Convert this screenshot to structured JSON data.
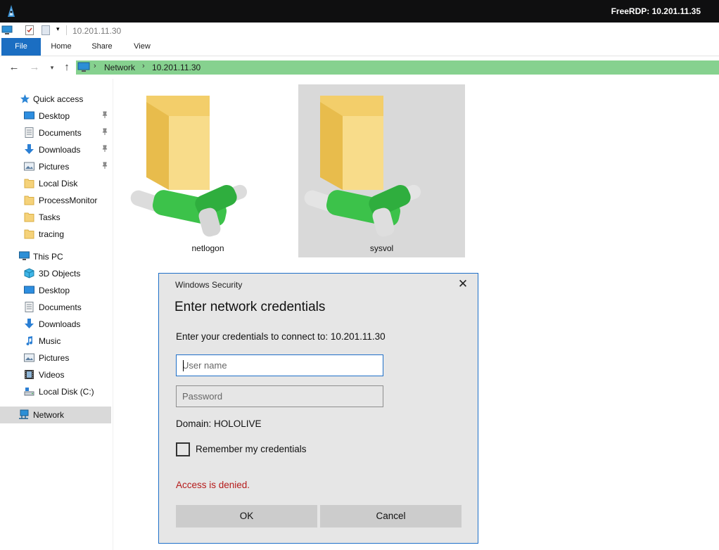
{
  "rdp": {
    "title": "FreeRDP: 10.201.11.35"
  },
  "window": {
    "title": "10.201.11.30"
  },
  "ribbon": {
    "tabs": [
      "File",
      "Home",
      "Share",
      "View"
    ]
  },
  "address": {
    "crumbs": [
      "Network",
      "10.201.11.30"
    ],
    "accent": "#86d18f"
  },
  "sidebar": {
    "quick_access": "Quick access",
    "quick_items": [
      "Desktop",
      "Documents",
      "Downloads",
      "Pictures",
      "Local Disk",
      "ProcessMonitor",
      "Tasks",
      "tracing"
    ],
    "this_pc": "This PC",
    "pc_items": [
      "3D Objects",
      "Desktop",
      "Documents",
      "Downloads",
      "Music",
      "Pictures",
      "Videos",
      "Local Disk (C:)"
    ],
    "network": "Network"
  },
  "content": {
    "folders": [
      "netlogon",
      "sysvol"
    ]
  },
  "dialog": {
    "title": "Windows Security",
    "heading": "Enter network credentials",
    "prompt": "Enter your credentials to connect to: 10.201.11.30",
    "username_placeholder": "User name",
    "password_placeholder": "Password",
    "domain": "Domain: HOLOLIVE",
    "remember": "Remember my credentials",
    "error": "Access is denied.",
    "ok": "OK",
    "cancel": "Cancel",
    "error_color": "#b51a1a"
  }
}
